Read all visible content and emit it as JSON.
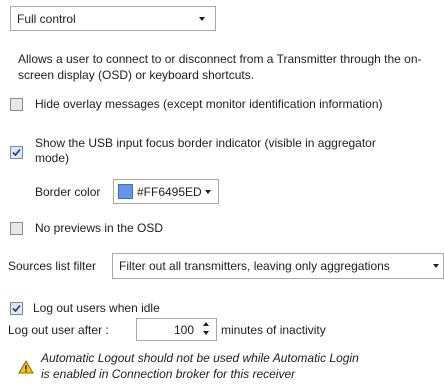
{
  "access_dropdown": {
    "value": "Full control"
  },
  "description": "Allows a user to connect to or disconnect from a Transmitter through the on-screen display (OSD) or keyboard shortcuts.",
  "hide_overlay": {
    "label": "Hide overlay messages (except monitor identification information)",
    "checked": false
  },
  "usb_focus": {
    "label": "Show the USB input focus border indicator (visible in aggregator mode)",
    "checked": true
  },
  "border_color": {
    "label": "Border color",
    "value": "#FF6495ED",
    "swatch": "#6495ED"
  },
  "no_previews": {
    "label": "No previews in the OSD",
    "checked": false
  },
  "sources_filter": {
    "label": "Sources list filter",
    "value": "Filter out all transmitters, leaving only aggregations"
  },
  "logout_idle": {
    "label": "Log out users when idle",
    "checked": true
  },
  "logout_after": {
    "label": "Log out user after :",
    "value": "100",
    "suffix": "minutes of inactivity"
  },
  "warning": {
    "text": "Automatic Logout should not be used while Automatic Login is enabled in Connection broker for this receiver",
    "icon": "warning-icon"
  }
}
